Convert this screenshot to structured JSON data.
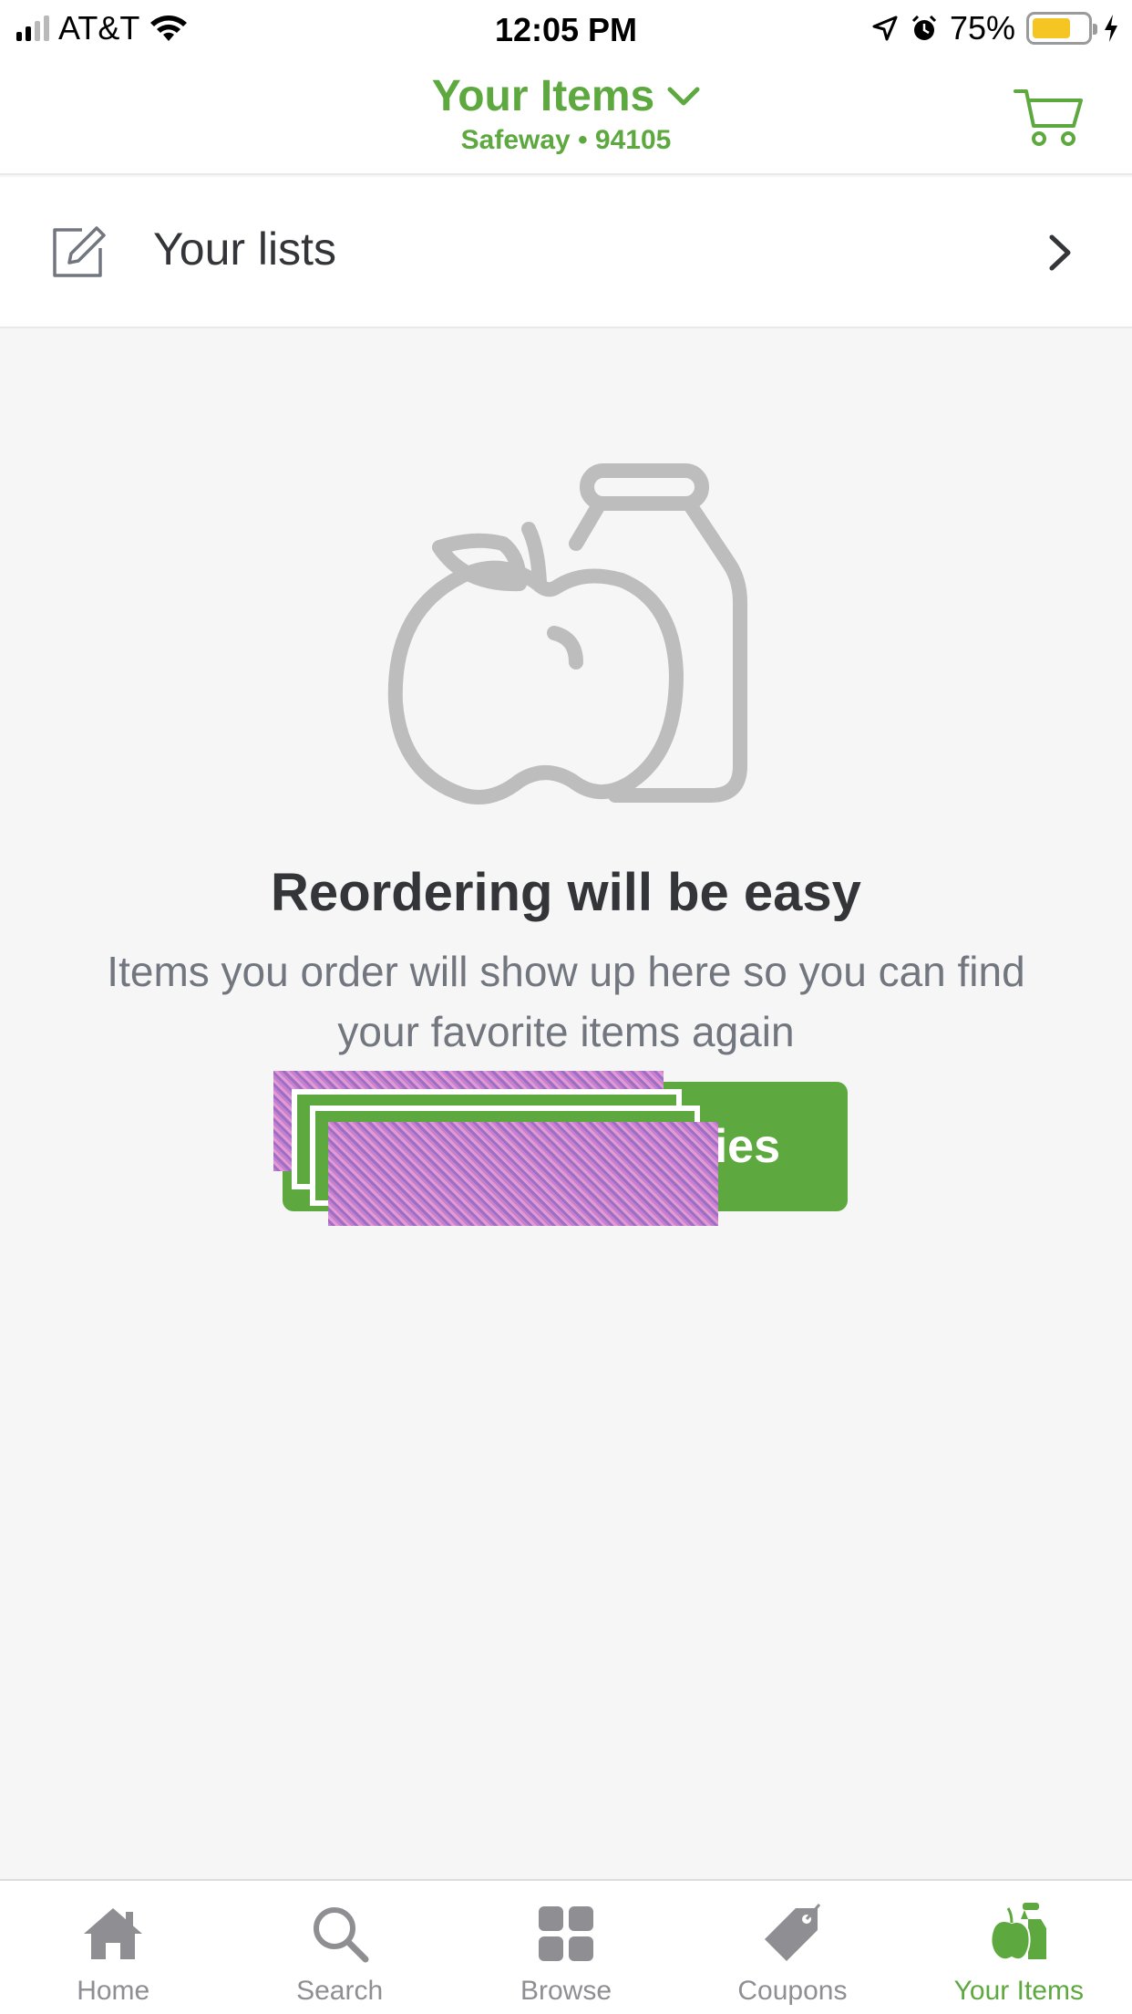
{
  "status_bar": {
    "carrier": "AT&T",
    "time": "12:05 PM",
    "battery": "75%",
    "battery_level": 0.75
  },
  "header": {
    "title": "Your Items",
    "subtitle": "Safeway • 94105",
    "cart_icon": "cart-icon",
    "dropdown_icon": "chevron-down-icon"
  },
  "lists_row": {
    "label": "Your lists",
    "icon": "edit-icon"
  },
  "empty_state": {
    "title": "Reordering will be easy",
    "body": "Items you order will show up here so you can find your favorite items again",
    "cta_label": "ies"
  },
  "tabs": [
    {
      "label": "Home",
      "icon": "home-icon"
    },
    {
      "label": "Search",
      "icon": "search-icon"
    },
    {
      "label": "Browse",
      "icon": "grid-icon"
    },
    {
      "label": "Coupons",
      "icon": "tag-icon"
    },
    {
      "label": "Your Items",
      "icon": "apple-icon",
      "active": true
    }
  ],
  "colors": {
    "brand_green": "#5da83f",
    "text_dark": "#343538",
    "text_muted": "#72767e",
    "background": "#f6f6f6",
    "tab_inactive": "#8e8e93"
  }
}
